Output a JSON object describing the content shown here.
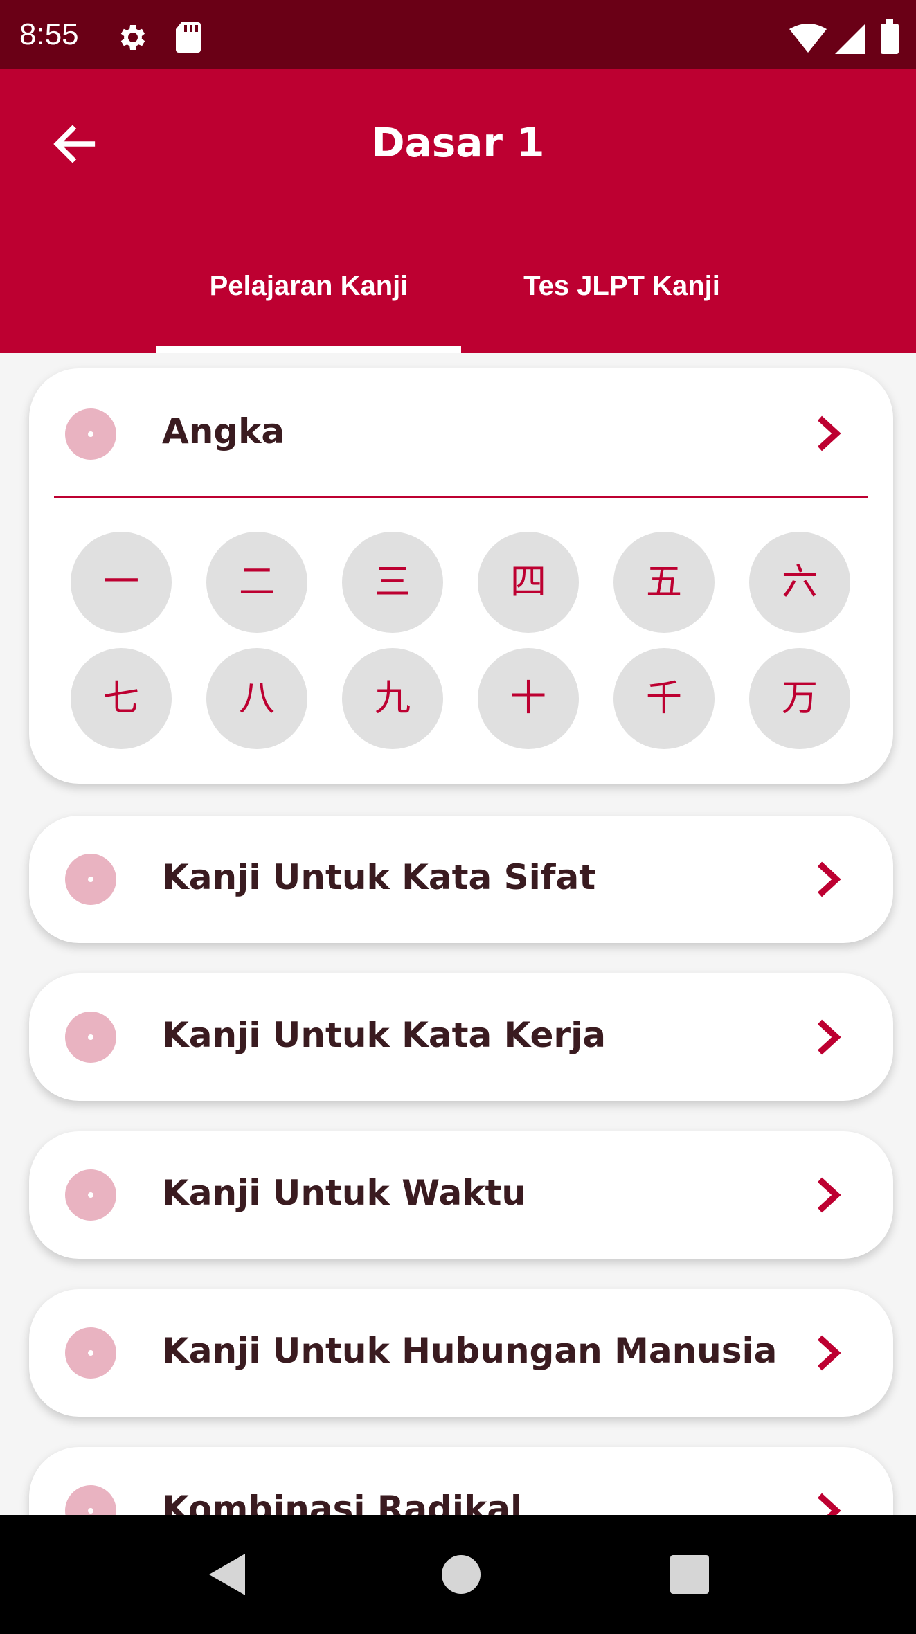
{
  "status_bar": {
    "time": "8:55",
    "icons": [
      "settings-gear-icon",
      "sd-card-icon",
      "wifi-icon",
      "cell-signal-icon",
      "battery-icon"
    ]
  },
  "app_bar": {
    "title": "Dasar 1",
    "back_icon": "arrow-left-icon",
    "tabs": [
      {
        "label": "Pelajaran Kanji",
        "selected": true
      },
      {
        "label": "Tes JLPT Kanji",
        "selected": false
      }
    ]
  },
  "lessons": {
    "expanded": {
      "title": "Angka",
      "kanji": [
        "一",
        "二",
        "三",
        "四",
        "五",
        "六",
        "七",
        "八",
        "九",
        "十",
        "千",
        "万"
      ]
    },
    "items": [
      {
        "title": "Kanji Untuk Kata Sifat"
      },
      {
        "title": "Kanji Untuk Kata Kerja"
      },
      {
        "title": "Kanji Untuk Waktu"
      },
      {
        "title": "Kanji Untuk Hubungan Manusia"
      },
      {
        "title": "Kombinasi Radikal"
      }
    ]
  },
  "nav_bar": {
    "icons": [
      "back-triangle-icon",
      "home-circle-icon",
      "recents-square-icon"
    ]
  },
  "colors": {
    "status_bar": "#6a0016",
    "primary": "#bd0031",
    "dot": "#e9b3c1",
    "kanji_bg": "#e0e0e0",
    "text_dark": "#3a1b20"
  }
}
